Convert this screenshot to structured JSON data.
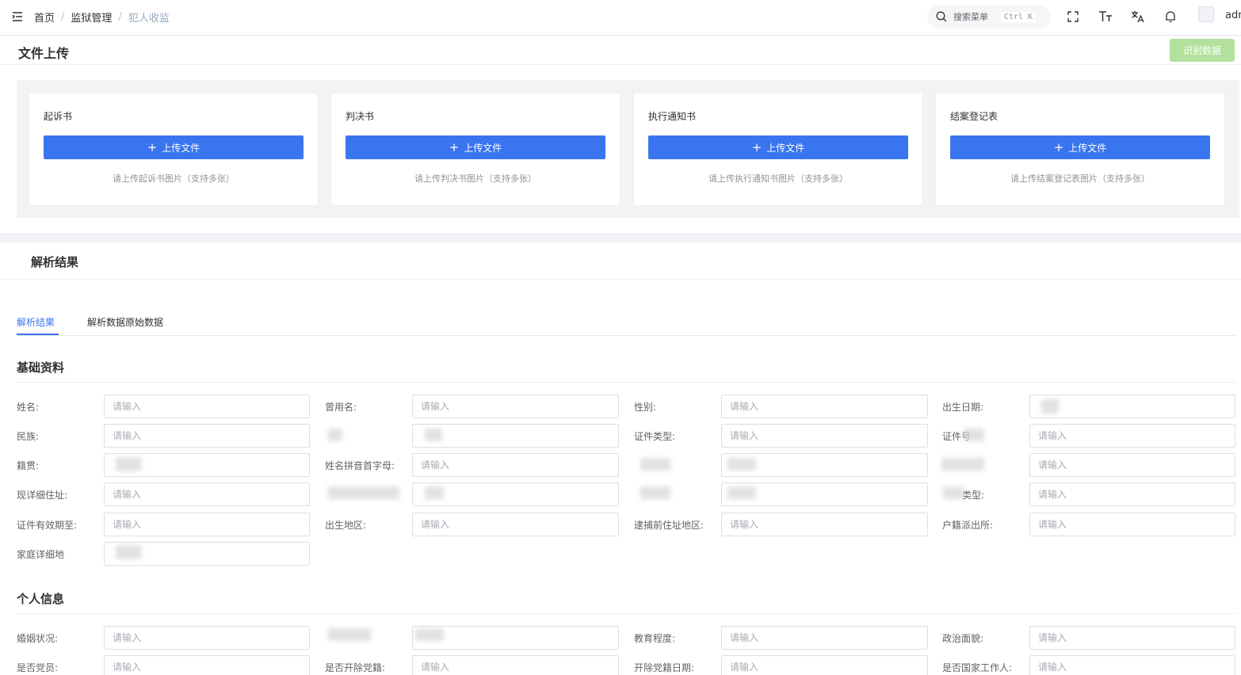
{
  "breadcrumb": [
    "首页",
    "监狱管理",
    "犯人收监"
  ],
  "header": {
    "search_placeholder": "搜索菜单",
    "search_shortcut": "Ctrl K",
    "username": "admin"
  },
  "upload": {
    "title": "文件上传",
    "recognize_label": "识别数据",
    "cards": [
      {
        "title": "起诉书",
        "button": "上传文件",
        "hint": "请上传起诉书图片（支持多张）"
      },
      {
        "title": "判决书",
        "button": "上传文件",
        "hint": "请上传判决书图片（支持多张）"
      },
      {
        "title": "执行通知书",
        "button": "上传文件",
        "hint": "请上传执行通知书图片（支持多张）"
      },
      {
        "title": "结案登记表",
        "button": "上传文件",
        "hint": "请上传结案登记表图片（支持多张）"
      }
    ]
  },
  "result": {
    "title": "解析结果",
    "tabs": [
      "解析结果",
      "解析数据原始数据"
    ],
    "placeholder": "请输入",
    "basic": {
      "title": "基础资料",
      "labels": {
        "name": "姓名:",
        "alias": "曾用名:",
        "gender": "性别:",
        "birth": "出生日期:",
        "ethnic": "民族:",
        "id_type": "证件类型:",
        "id_no": "证件号",
        "native": "籍贯:",
        "pinyin": "姓名拼音首字母:",
        "address": "现详细住址:",
        "huji_type": "类型:",
        "id_expire": "证件有效期至:",
        "birth_area": "出生地区:",
        "arrest_addr": "逮捕前住址地区:",
        "huji_police": "户籍派出所:",
        "home_addr": "家庭详细地"
      }
    },
    "personal": {
      "title": "个人信息",
      "labels": {
        "marital": "婚姻状况:",
        "education": "教育程度:",
        "political": "政治面貌:",
        "party": "是否党员:",
        "expelled": "是否开除党籍:",
        "expel_date": "开除党籍日期:",
        "civil_servant": "是否国家工作人:"
      }
    }
  }
}
